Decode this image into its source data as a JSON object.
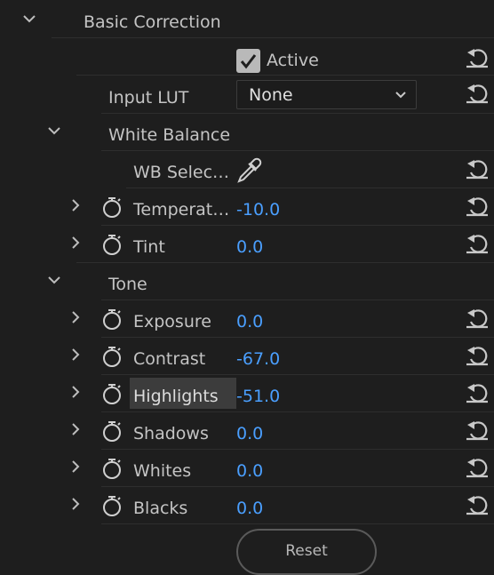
{
  "sections": {
    "basic_correction": "Basic Correction",
    "white_balance": "White Balance",
    "tone": "Tone"
  },
  "active": {
    "label": "Active",
    "checked": true
  },
  "input_lut": {
    "label": "Input LUT",
    "value": "None"
  },
  "wb_selector": {
    "label": "WB Selec…"
  },
  "params": [
    {
      "label": "Temperat…",
      "value": "-10.0"
    },
    {
      "label": "Tint",
      "value": "0.0"
    },
    {
      "label": "Exposure",
      "value": "0.0"
    },
    {
      "label": "Contrast",
      "value": "-67.0"
    },
    {
      "label": "Highlights",
      "value": "-51.0"
    },
    {
      "label": "Shadows",
      "value": "0.0"
    },
    {
      "label": "Whites",
      "value": "0.0"
    },
    {
      "label": "Blacks",
      "value": "0.0"
    }
  ],
  "reset_button": {
    "label": "Reset"
  },
  "colors": {
    "background": "#1e1e1e",
    "value_blue": "#4a9fff",
    "label_gray": "#c4c4c4"
  },
  "icons": [
    "chevron-down-icon",
    "chevron-right-icon",
    "stopwatch-icon",
    "reset-arrow-icon",
    "eyedropper-icon",
    "checkmark-icon"
  ]
}
